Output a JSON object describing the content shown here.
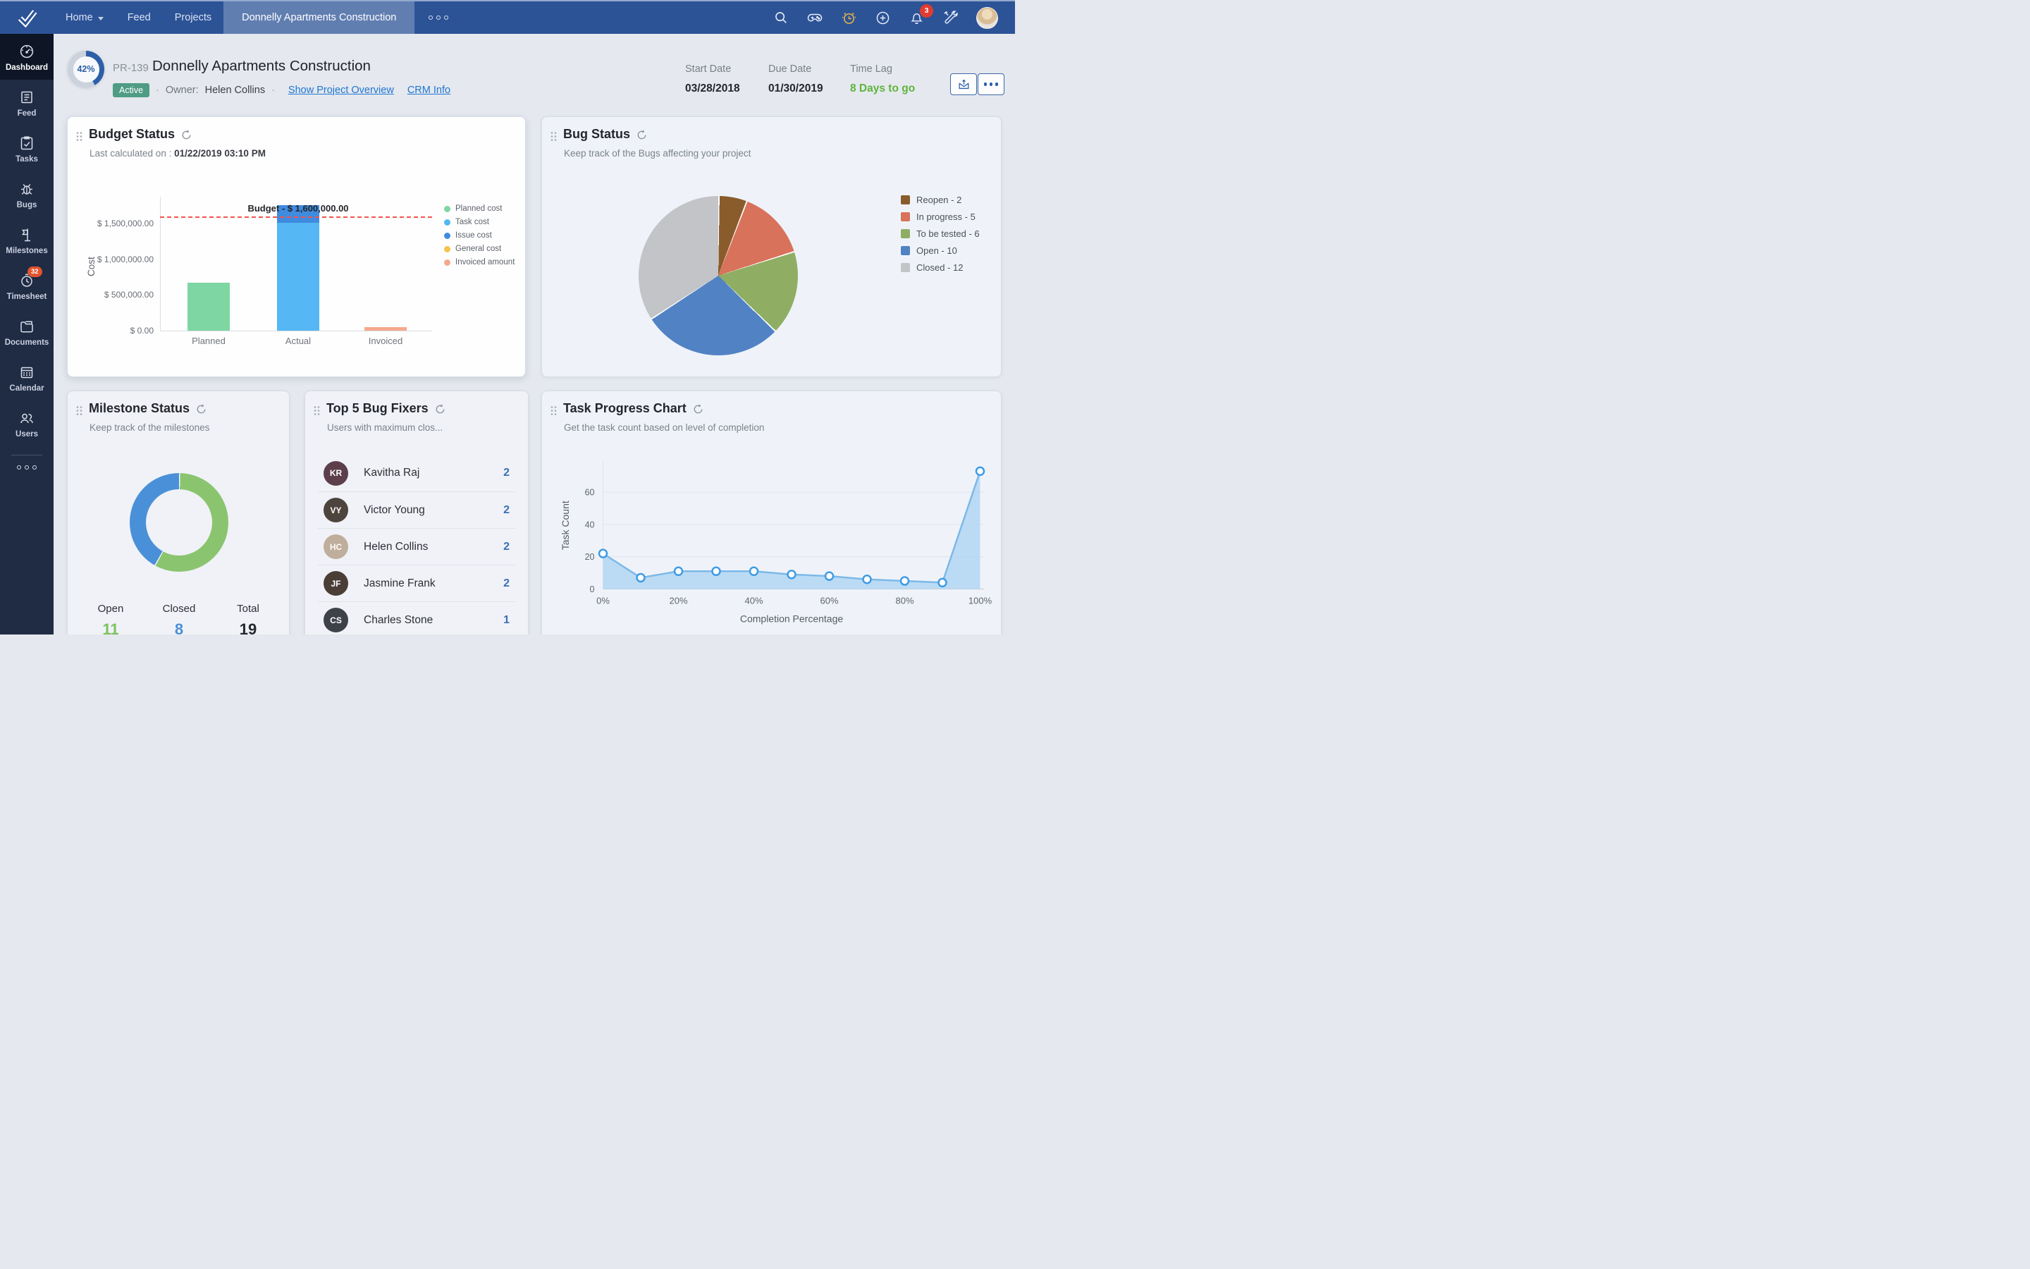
{
  "nav": {
    "items": [
      {
        "label": "Home",
        "dropdown": true
      },
      {
        "label": "Feed"
      },
      {
        "label": "Projects"
      }
    ],
    "active_tab": "Donnelly Apartments Construction",
    "notification_count": "3"
  },
  "sidebar": {
    "items": [
      {
        "label": "Dashboard",
        "icon": "dashboard",
        "active": true
      },
      {
        "label": "Feed",
        "icon": "feed"
      },
      {
        "label": "Tasks",
        "icon": "tasks"
      },
      {
        "label": "Bugs",
        "icon": "bugs"
      },
      {
        "label": "Milestones",
        "icon": "milestones"
      },
      {
        "label": "Timesheet",
        "icon": "timesheet",
        "badge": "32"
      },
      {
        "label": "Documents",
        "icon": "documents"
      },
      {
        "label": "Calendar",
        "icon": "calendar"
      },
      {
        "label": "Users",
        "icon": "users"
      }
    ]
  },
  "header": {
    "progress": "42%",
    "project_id": "PR-139",
    "title": "Donnelly Apartments Construction",
    "status": "Active",
    "owner_label": "Owner:",
    "owner_name": "Helen Collins",
    "overview_link": "Show Project Overview",
    "crm_link": "CRM Info",
    "stats": [
      {
        "label": "Start Date",
        "value": "03/28/2018"
      },
      {
        "label": "Due Date",
        "value": "01/30/2019"
      },
      {
        "label": "Time Lag",
        "value": "8 Days to go",
        "highlight": true
      }
    ]
  },
  "cards": {
    "budget": {
      "title": "Budget Status",
      "last_calc_label": "Last calculated on :",
      "last_calc_value": "01/22/2019 03:10 PM"
    },
    "bug_status": {
      "title": "Bug Status",
      "subtitle": "Keep track of the Bugs affecting your project"
    },
    "milestones": {
      "title": "Milestone Status",
      "subtitle": "Keep track of the milestones",
      "stats": [
        {
          "label": "Open",
          "value": "11",
          "color": "#7cc15e"
        },
        {
          "label": "Closed",
          "value": "8",
          "color": "#4a90d8"
        },
        {
          "label": "Total",
          "value": "19",
          "color": "#26292e"
        }
      ]
    },
    "bug_fixers": {
      "title": "Top 5 Bug Fixers",
      "subtitle": "Users with maximum clos...",
      "rows": [
        {
          "name": "Kavitha Raj",
          "count": "2",
          "initials": "KR",
          "avatar_bg": "#5d3f4c"
        },
        {
          "name": "Victor Young",
          "count": "2",
          "initials": "VY",
          "avatar_bg": "#4e443e"
        },
        {
          "name": "Helen Collins",
          "count": "2",
          "initials": "HC",
          "avatar_bg": "#bfae9b"
        },
        {
          "name": "Jasmine Frank",
          "count": "2",
          "initials": "JF",
          "avatar_bg": "#4b3e37"
        },
        {
          "name": "Charles Stone",
          "count": "1",
          "initials": "CS",
          "avatar_bg": "#3d4248"
        }
      ]
    },
    "task_progress": {
      "title": "Task Progress Chart",
      "subtitle": "Get the task count based on level of completion"
    }
  },
  "chart_data": [
    {
      "id": "budget",
      "type": "bar",
      "title": "Budget Status",
      "ylabel": "Cost",
      "categories": [
        "Planned",
        "Actual",
        "Invoiced"
      ],
      "yticks": [
        {
          "label": "$ 0.00",
          "value": 0
        },
        {
          "label": "$ 500,000.00",
          "value": 500000
        },
        {
          "label": "$ 1,000,000.00",
          "value": 1000000
        },
        {
          "label": "$ 1,500,000.00",
          "value": 1500000
        }
      ],
      "bars": [
        {
          "category": "Planned",
          "segments": [
            {
              "series": "Planned cost",
              "value": 675000,
              "color": "#7ed6a3"
            }
          ]
        },
        {
          "category": "Actual",
          "segments": [
            {
              "series": "Task cost",
              "value": 1510000,
              "color": "#55b7f3"
            },
            {
              "series": "Issue cost",
              "value": 250000,
              "color": "#3f8bdf"
            }
          ]
        },
        {
          "category": "Invoiced",
          "segments": [
            {
              "series": "Invoiced amount",
              "value": 50000,
              "color": "#f6a88d"
            }
          ]
        }
      ],
      "budget_line": {
        "label": "Budget - $ 1,600,000.00",
        "value": 1600000,
        "color": "#f4534b"
      },
      "legend": [
        {
          "label": "Planned cost",
          "color": "#7ed6a3"
        },
        {
          "label": "Task cost",
          "color": "#55b7f3"
        },
        {
          "label": "Issue cost",
          "color": "#3f8bdf"
        },
        {
          "label": "General cost",
          "color": "#f6c24c"
        },
        {
          "label": "Invoiced amount",
          "color": "#f6a88d"
        }
      ]
    },
    {
      "id": "bug_status",
      "type": "pie",
      "title": "Bug Status",
      "slices": [
        {
          "label": "Reopen",
          "value": 2,
          "color": "#8a5c2b"
        },
        {
          "label": "In progress",
          "value": 5,
          "color": "#d9725a"
        },
        {
          "label": "To be tested",
          "value": 6,
          "color": "#8fae63"
        },
        {
          "label": "Open",
          "value": 10,
          "color": "#5182c4"
        },
        {
          "label": "Closed",
          "value": 12,
          "color": "#c3c4c8"
        }
      ],
      "legend_position": "right"
    },
    {
      "id": "milestone_status",
      "type": "donut",
      "title": "Milestone Status",
      "slices": [
        {
          "label": "Open",
          "value": 11,
          "color": "#8bc46f"
        },
        {
          "label": "Closed",
          "value": 8,
          "color": "#4a90d8"
        }
      ],
      "total": 19
    },
    {
      "id": "task_progress",
      "type": "area",
      "title": "Task Progress Chart",
      "x": [
        "0%",
        "10%",
        "20%",
        "30%",
        "40%",
        "50%",
        "60%",
        "70%",
        "80%",
        "90%",
        "100%"
      ],
      "values": [
        22,
        7,
        11,
        11,
        11,
        9,
        8,
        6,
        5,
        4,
        73
      ],
      "xticks": [
        "0%",
        "20%",
        "40%",
        "60%",
        "80%",
        "100%"
      ],
      "xlabel": "Completion Percentage",
      "ylabel": "Task Count",
      "yticks": [
        0,
        20,
        40,
        60
      ],
      "ylim": [
        0,
        78
      ],
      "line_color": "#7cb9e8",
      "fill_color": "#aed4f4",
      "marker_color": "#3f9be4",
      "grid": true
    }
  ]
}
